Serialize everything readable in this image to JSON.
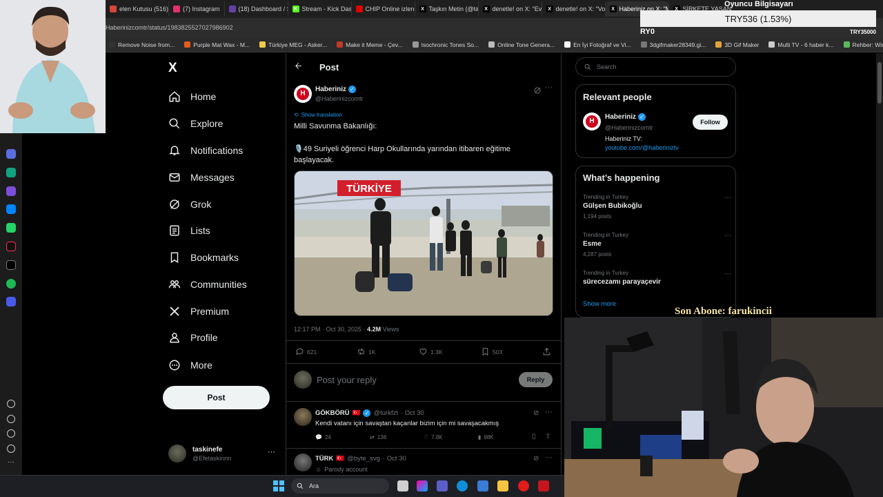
{
  "browser": {
    "tabs": [
      {
        "label": "elen Kutusu (516)",
        "color": "#d44638",
        "glyph": ""
      },
      {
        "label": "(7) Instagram",
        "color": "#e1306c",
        "glyph": ""
      },
      {
        "label": "(18) Dashboard / S",
        "color": "#6441a5",
        "glyph": ""
      },
      {
        "label": "Stream - Kick Dash",
        "color": "#53fc18",
        "glyph": "K"
      },
      {
        "label": "CHIP Online izlene",
        "color": "#e00000",
        "glyph": ""
      },
      {
        "label": "Taşkın Metin (@ta",
        "color": "#000000",
        "glyph": "X"
      },
      {
        "label": "denetle! on X: \"Ev",
        "color": "#000000",
        "glyph": "X"
      },
      {
        "label": "denetle! on X: \"Vo",
        "color": "#000000",
        "glyph": "X"
      },
      {
        "label": "Haberiniz on X: \"Milli Sav",
        "color": "#000000",
        "glyph": "X"
      },
      {
        "label": "ŞİRKETE YAŞANDI",
        "color": "#000000",
        "glyph": "X"
      }
    ],
    "active_tab_index": 8,
    "url": "Haberinizcomtr/status/1983825527027986902",
    "bookmarks": [
      {
        "label": "Remove Noise from...",
        "color": "#333333"
      },
      {
        "label": "Purple Mat Wax - M...",
        "color": "#e45c1c"
      },
      {
        "label": "Türkiye MEG - Asker...",
        "color": "#f2c94c"
      },
      {
        "label": "Make it Meme - Çev...",
        "color": "#c0392b"
      },
      {
        "label": "Isochronic Tones So...",
        "color": "#999999"
      },
      {
        "label": "Online Tone Genera...",
        "color": "#bbbbbb"
      },
      {
        "label": "En İyi Fotoğraf ve Vi...",
        "color": "#ffffff"
      },
      {
        "label": "3dgifmaker28349.gi...",
        "color": "#777777"
      },
      {
        "label": "3D Gif Maker",
        "color": "#e6a23c"
      },
      {
        "label": "Multi TV - 6 haber k...",
        "color": "#cccccc"
      },
      {
        "label": "Rehber: Windows 1...",
        "color": "#5cb85c"
      }
    ]
  },
  "overlay": {
    "ticker": "TRY536 (1.53%)",
    "oyuncu": "Oyuncu Bilgisayarı",
    "ry0": "RY0",
    "try35000": "TRY35000",
    "son_abone": "Son Abone: farukincii"
  },
  "sidebar": {
    "logo": "X",
    "items": [
      {
        "label": "Home",
        "icon": "home-icon"
      },
      {
        "label": "Explore",
        "icon": "search-icon"
      },
      {
        "label": "Notifications",
        "icon": "bell-icon"
      },
      {
        "label": "Messages",
        "icon": "mail-icon"
      },
      {
        "label": "Grok",
        "icon": "grok-icon"
      },
      {
        "label": "Lists",
        "icon": "list-icon"
      },
      {
        "label": "Bookmarks",
        "icon": "bookmark-icon"
      },
      {
        "label": "Communities",
        "icon": "people-icon"
      },
      {
        "label": "Premium",
        "icon": "x-icon"
      },
      {
        "label": "Profile",
        "icon": "person-icon"
      },
      {
        "label": "More",
        "icon": "more-icon"
      }
    ],
    "post_button": "Post",
    "account": {
      "name": "taskinefe",
      "handle": "@Efetaskinnn"
    }
  },
  "post": {
    "header_title": "Post",
    "author": "Haberiniz",
    "handle": "@Haberinizcomtr",
    "show_translation": "Show translation",
    "text_line1": "Milli Savunma Bakanlığı:",
    "text_line2": "🎙️49 Suriyeli öğrenci Harp Okullarında yarından itibaren eğitime başlayacak.",
    "image_sign": "TÜRKİYE",
    "time": "12:17 PM · Oct 30, 2025 ·",
    "views_count": "4.2M",
    "views_label": "Views",
    "replies": "621",
    "reposts": "1K",
    "likes": "1.3K",
    "bookmarks": "503",
    "reply_placeholder": "Post your reply",
    "reply_button": "Reply"
  },
  "replies": [
    {
      "author": "GÖKBÖRÜ",
      "flag": "🇹🇷",
      "handle": "@turkfzt",
      "date": "· Oct 30",
      "text": "Kendi vatanı için savaştan kaçanlar bizim için mi savaşacakmış",
      "replies": "24",
      "reposts": "138",
      "likes": "7.8K",
      "views": "88K"
    },
    {
      "author": "TÜRK",
      "flag": "🇹🇷",
      "handle": "@byte_svg",
      "date": "· Oct 30",
      "text": "Parody account"
    }
  ],
  "right": {
    "search_placeholder": "Search",
    "relevant_title": "Relevant people",
    "relevant": {
      "name": "Haberiniz",
      "handle": "@Haberinizcomtr",
      "bio": "Haberiniz TV:",
      "link": "youtube.com/@haberiniztv",
      "follow": "Follow"
    },
    "happening_title": "What’s happening",
    "trends": [
      {
        "context": "Trending in Turkey",
        "name": "Gülşen Bubikoğlu",
        "count": "1,194 posts"
      },
      {
        "context": "Trending in Turkey",
        "name": "Esme",
        "count": "4,287 posts"
      },
      {
        "context": "Trending in Turkey",
        "name": "sürecezamı parayaçevir",
        "count": ""
      }
    ],
    "show_more": "Show more"
  },
  "taskbar": {
    "search_label": "Ara"
  },
  "colors": {
    "accent": "#1d9bf0",
    "brand_red": "#d0021b",
    "bg": "#000000",
    "border": "#2f3336"
  }
}
